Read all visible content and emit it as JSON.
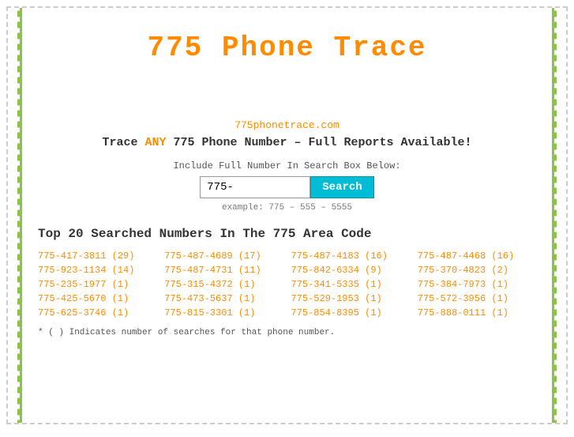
{
  "page": {
    "title": "775 Phone Trace",
    "site_url": "775phonetrace.com",
    "tagline_prefix": "Trace ",
    "tagline_any": "ANY",
    "tagline_suffix": " 775 Phone Number – Full Reports Available!",
    "search_label": "Include Full Number In Search Box Below:",
    "search_input_value": "775-",
    "search_button_label": "Search",
    "search_example": "example: 775 – 555 – 5555",
    "top_numbers_title": "Top 20 Searched Numbers In The 775 Area Code",
    "footnote": "* ( ) Indicates number of searches for that phone number.",
    "phone_numbers": [
      "775-417-3811 (29)",
      "775-487-4689 (17)",
      "775-487-4183 (16)",
      "775-487-4468 (16)",
      "775-923-1134 (14)",
      "775-487-4731 (11)",
      "775-842-6334 (9)",
      "775-370-4823 (2)",
      "775-235-1977 (1)",
      "775-315-4372 (1)",
      "775-341-5335 (1)",
      "775-384-7973 (1)",
      "775-425-5670 (1)",
      "775-473-5637 (1)",
      "775-529-1953 (1)",
      "775-572-3956 (1)",
      "775-625-3746 (1)",
      "775-815-3301 (1)",
      "775-854-8395 (1)",
      "775-888-0111 (1)"
    ]
  }
}
